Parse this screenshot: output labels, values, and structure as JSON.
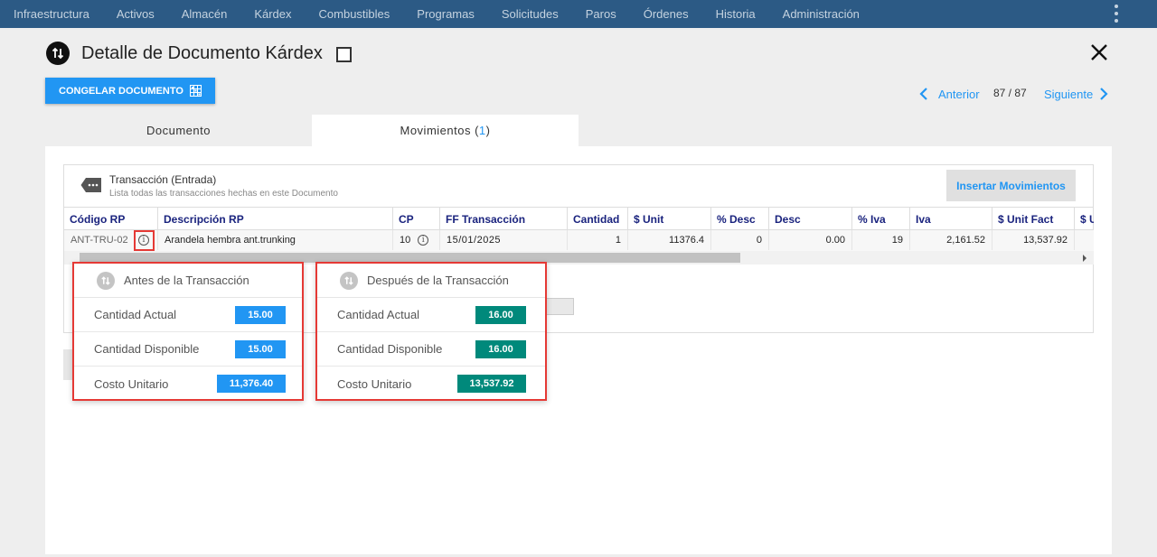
{
  "nav": {
    "items": [
      "Infraestructura",
      "Activos",
      "Almacén",
      "Kárdex",
      "Combustibles",
      "Programas",
      "Solicitudes",
      "Paros",
      "Órdenes",
      "Historia",
      "Administración"
    ]
  },
  "header": {
    "title": "Detalle de Documento Kárdex",
    "freeze_button": "CONGELAR DOCUMENTO"
  },
  "pager": {
    "prev": "Anterior",
    "count": "87 / 87",
    "next": "Siguiente"
  },
  "tabs": {
    "documento": "Documento",
    "movimientos": "Movimientos",
    "movimientos_count": "1"
  },
  "card": {
    "title": "Transacción (Entrada)",
    "subtitle": "Lista todas las transacciones hechas en este Documento",
    "insert_button": "Insertar Movimientos"
  },
  "table": {
    "columns": [
      "Código RP",
      "Descripción RP",
      "CP",
      "FF Transacción",
      "Cantidad",
      "$ Unit",
      "% Desc",
      "Desc",
      "% Iva",
      "Iva",
      "$ Unit Fact",
      "$ U"
    ],
    "row": {
      "codigo": "ANT-TRU-02",
      "descripcion": "Arandela hembra ant.trunking",
      "cp": "10",
      "ff": "15/01/2025",
      "cantidad": "1",
      "unit": "11376.4",
      "pdesc": "0",
      "desc": "0.00",
      "piva": "19",
      "iva": "2,161.52",
      "unit_fact": "13,537.92"
    }
  },
  "before": {
    "title": "Antes de la Transacción",
    "rows": [
      {
        "label": "Cantidad Actual",
        "value": "15.00"
      },
      {
        "label": "Cantidad Disponible",
        "value": "15.00"
      },
      {
        "label": "Costo Unitario",
        "value": "11,376.40"
      }
    ]
  },
  "after": {
    "title": "Después de la Transacción",
    "rows": [
      {
        "label": "Cantidad Actual",
        "value": "16.00"
      },
      {
        "label": "Cantidad Disponible",
        "value": "16.00"
      },
      {
        "label": "Costo Unitario",
        "value": "13,537.92"
      }
    ]
  },
  "colors": {
    "nav_bg": "#2c5a85",
    "accent_blue": "#2196f3",
    "teal": "#00897b",
    "highlight_red": "#e53935",
    "header_text": "#1a237e"
  }
}
